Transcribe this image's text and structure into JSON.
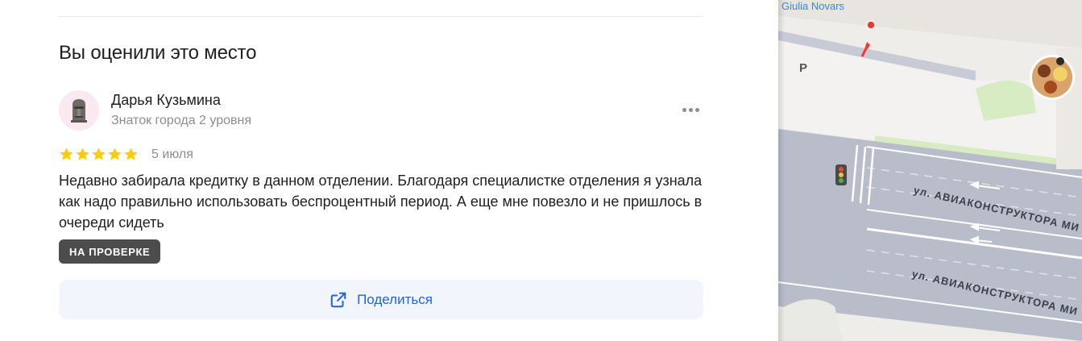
{
  "review_section": {
    "title": "Вы оценили это место",
    "author": {
      "name": "Дарья Кузьмина",
      "level": "Знаток города 2 уровня"
    },
    "rating": 5,
    "rating_max": 5,
    "date": "5 июля",
    "text": "Недавно забирала кредитку в данном отделении. Благодаря специалистке отделения я узнала как надо правильно использовать беспроцентный период. А еще мне повезло и не пришлось в очереди сидеть",
    "status_badge": "НА ПРОВЕРКЕ",
    "share_label": "Поделиться"
  },
  "map": {
    "place_label": "Giulia Novars",
    "parking_label": "P",
    "road_labels": [
      "ул. АВИАКОНСТРУКТОРА МИ",
      "ул. АВИАКОНСТРУКТОРА МИ"
    ]
  },
  "colors": {
    "accent": "#1f65d6",
    "star": "#fc0",
    "badge_bg": "#4c4c4c",
    "share_bg": "#f2f5fc",
    "map_pin": "#f33"
  },
  "icons": {
    "more": "ellipsis-icon",
    "share": "share-external-icon",
    "star": "star-icon",
    "traffic_light": "traffic-light-icon",
    "pin": "location-pin-icon"
  }
}
